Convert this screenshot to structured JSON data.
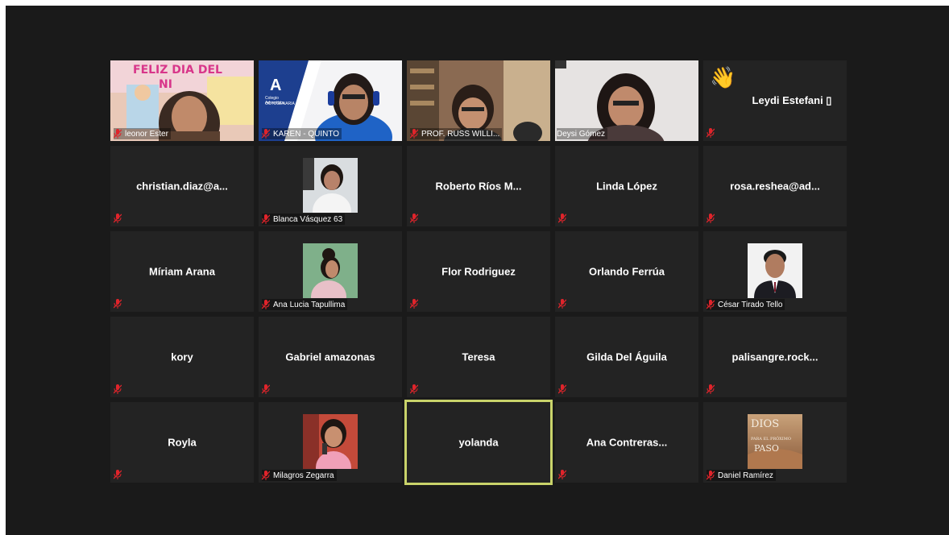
{
  "participants": [
    {
      "name": "leonor Ester"
    },
    {
      "name": "KAREN - QUINTO"
    },
    {
      "name": "PROF. RUSS WILLI..."
    },
    {
      "name": "Deysi Gómez"
    },
    {
      "name": "Leydi  Estefani ▯"
    },
    {
      "name": "christian.diaz@a..."
    },
    {
      "name": "Blanca Vásquez 63"
    },
    {
      "name": "Roberto  Ríos  M..."
    },
    {
      "name": "Linda López"
    },
    {
      "name": "rosa.reshea@ad..."
    },
    {
      "name": "Míriam Arana"
    },
    {
      "name": "Ana Lucia Tapullima"
    },
    {
      "name": "Flor Rodriguez"
    },
    {
      "name": "Orlando Ferrúa"
    },
    {
      "name": "César Tirado Tello"
    },
    {
      "name": "kory"
    },
    {
      "name": "Gabriel amazonas"
    },
    {
      "name": "Teresa"
    },
    {
      "name": "Gilda Del Águila"
    },
    {
      "name": "palisangre.rock..."
    },
    {
      "name": "Royla"
    },
    {
      "name": "Milagros Zegarra"
    },
    {
      "name": "yolanda"
    },
    {
      "name": "Ana  Contreras..."
    },
    {
      "name": "Daniel Ramírez"
    }
  ],
  "video_text": {
    "banner": "FELIZ DIA DEL",
    "banner2": "NI",
    "logo_letter": "A",
    "logo_line1": "Colegio Adventista",
    "logo_line2": "OCTOGENARIA",
    "book_title1": "DIOS",
    "book_title2": "PARA EL PRÓXIMO",
    "book_title3": "PASO"
  },
  "colors": {
    "window_bg": "#1a1a1a",
    "tile_bg": "#232323",
    "active_speaker": "#c9d36a",
    "mute_icon": "#e0242b"
  }
}
